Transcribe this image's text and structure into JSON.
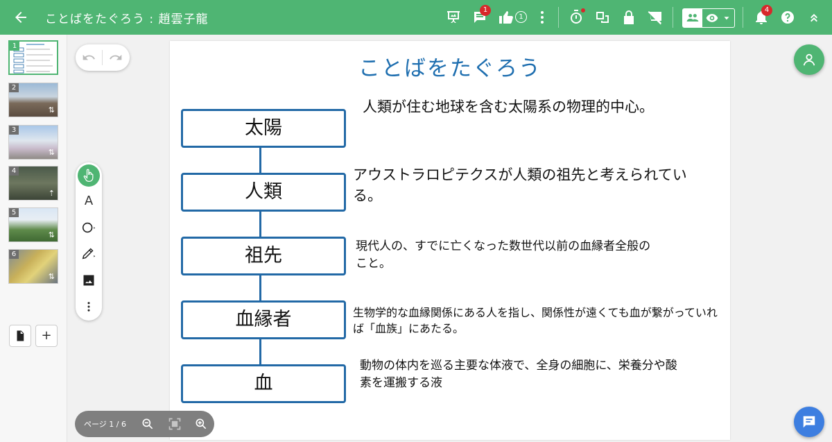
{
  "header": {
    "title": "ことばをたぐろう : 趙雲子龍",
    "comment_badge": "1",
    "like_count": "1",
    "notification_badge": "4"
  },
  "sidebar": {
    "slides": [
      {
        "num": "1",
        "active": true
      },
      {
        "num": "2"
      },
      {
        "num": "3"
      },
      {
        "num": "4"
      },
      {
        "num": "5"
      },
      {
        "num": "6"
      }
    ]
  },
  "slide": {
    "title": "ことばをたぐろう",
    "items": [
      {
        "term": "太陽",
        "desc": "人類が住む地球を含む太陽系の物理的中心。"
      },
      {
        "term": "人類",
        "desc": "アウストラロピテクスが人類の祖先と考えられている。"
      },
      {
        "term": "祖先",
        "desc": "現代人の、すでに亡くなった数世代以前の血縁者全般のこと。"
      },
      {
        "term": "血縁者",
        "desc": "生物学的な血縁関係にある人を指し、関係性が遠くても血が繋がっていれば「血族」にあたる。"
      },
      {
        "term": "血",
        "desc": "動物の体内を巡る主要な体液で、全身の細胞に、栄養分や酸素を運搬する液"
      }
    ]
  },
  "zoom": {
    "page_label": "ページ 1 / 6"
  },
  "colors": {
    "topbar": "#4fb573",
    "accent_blue": "#2269a6",
    "title_blue": "#1f6fb0",
    "chat_fab": "#3d7ee0"
  }
}
